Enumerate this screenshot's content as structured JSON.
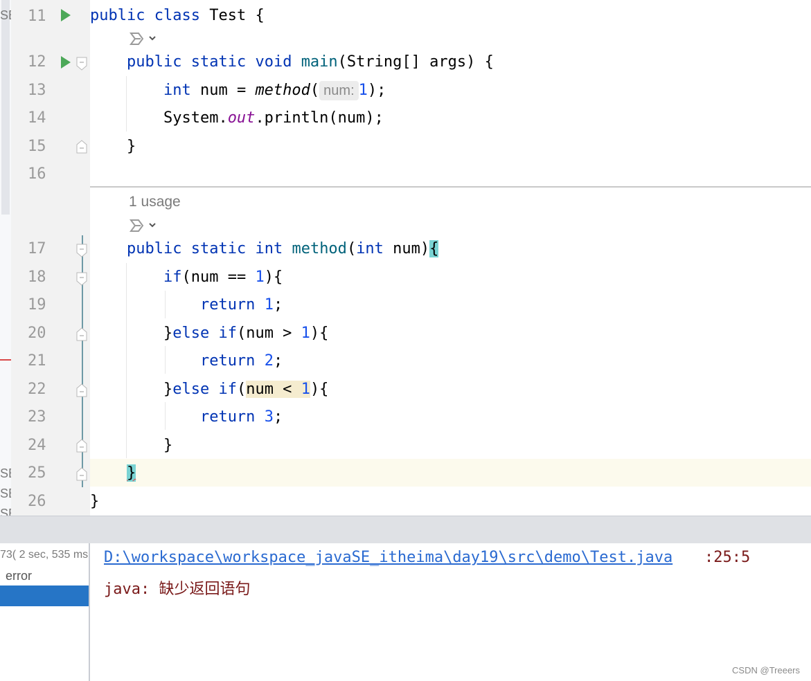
{
  "editor": {
    "line_numbers": [
      "11",
      "12",
      "13",
      "14",
      "15",
      "16",
      "17",
      "18",
      "19",
      "20",
      "21",
      "22",
      "23",
      "24",
      "25",
      "26"
    ],
    "usage_hint": "1 usage",
    "param_hint": "num:",
    "code": {
      "l11": {
        "kw1": "public",
        "kw2": "class",
        "rest": " Test {"
      },
      "l12": {
        "kw1": "public",
        "kw2": "static",
        "kw3": "void",
        "fn": "main",
        "rest": "(String[] args) {"
      },
      "l13": {
        "kw": "int",
        "mid": " num = ",
        "call": "method",
        "open": "(",
        "arg": "1",
        "close": ");"
      },
      "l14": {
        "a": "System.",
        "field": "out",
        "b": ".println(num);"
      },
      "l15": {
        "text": "}"
      },
      "l17": {
        "kw1": "public",
        "kw2": "static",
        "kw3": "int",
        "fn": "method",
        "open": "(",
        "kw4": "int",
        "rest": " num)",
        "brace": "{"
      },
      "l18": {
        "kw": "if",
        "a": "(num == ",
        "n": "1",
        "b": "){"
      },
      "l19": {
        "kw": "return",
        "n": "1",
        "b": ";"
      },
      "l20": {
        "a": "}",
        "kw1": "else",
        "kw2": "if",
        "b": "(num > ",
        "n": "1",
        "c": "){"
      },
      "l21": {
        "kw": "return",
        "n": "2",
        "b": ";"
      },
      "l22": {
        "a": "}",
        "kw1": "else",
        "kw2": "if",
        "b": "(",
        "hl1": "num < ",
        "n": "1",
        "c": "){"
      },
      "l23": {
        "kw": "return",
        "n": "3",
        "b": ";"
      },
      "l24": {
        "text": "}"
      },
      "l25": {
        "text": "}"
      },
      "l26": {
        "text": "}"
      }
    }
  },
  "left_strip": {
    "labels": [
      "SE",
      "SE",
      "SE",
      "SE"
    ]
  },
  "build_panel": {
    "time_label": "73( 2 sec, 535 ms",
    "status_label": "error",
    "output_path": "D:\\workspace\\workspace_javaSE_itheima\\day19\\src\\demo\\Test.java",
    "output_pos": ":25:5",
    "output_msg_prefix": "java: ",
    "output_msg_text": "缺少返回语句"
  },
  "watermark": "CSDN @Treeers",
  "colors": {
    "keyword": "#0033b3",
    "number": "#1750eb",
    "function": "#00627a",
    "field": "#871094",
    "error_text": "#7a1a1a",
    "link": "#2a6ad1",
    "run_icon": "#4ca858"
  }
}
